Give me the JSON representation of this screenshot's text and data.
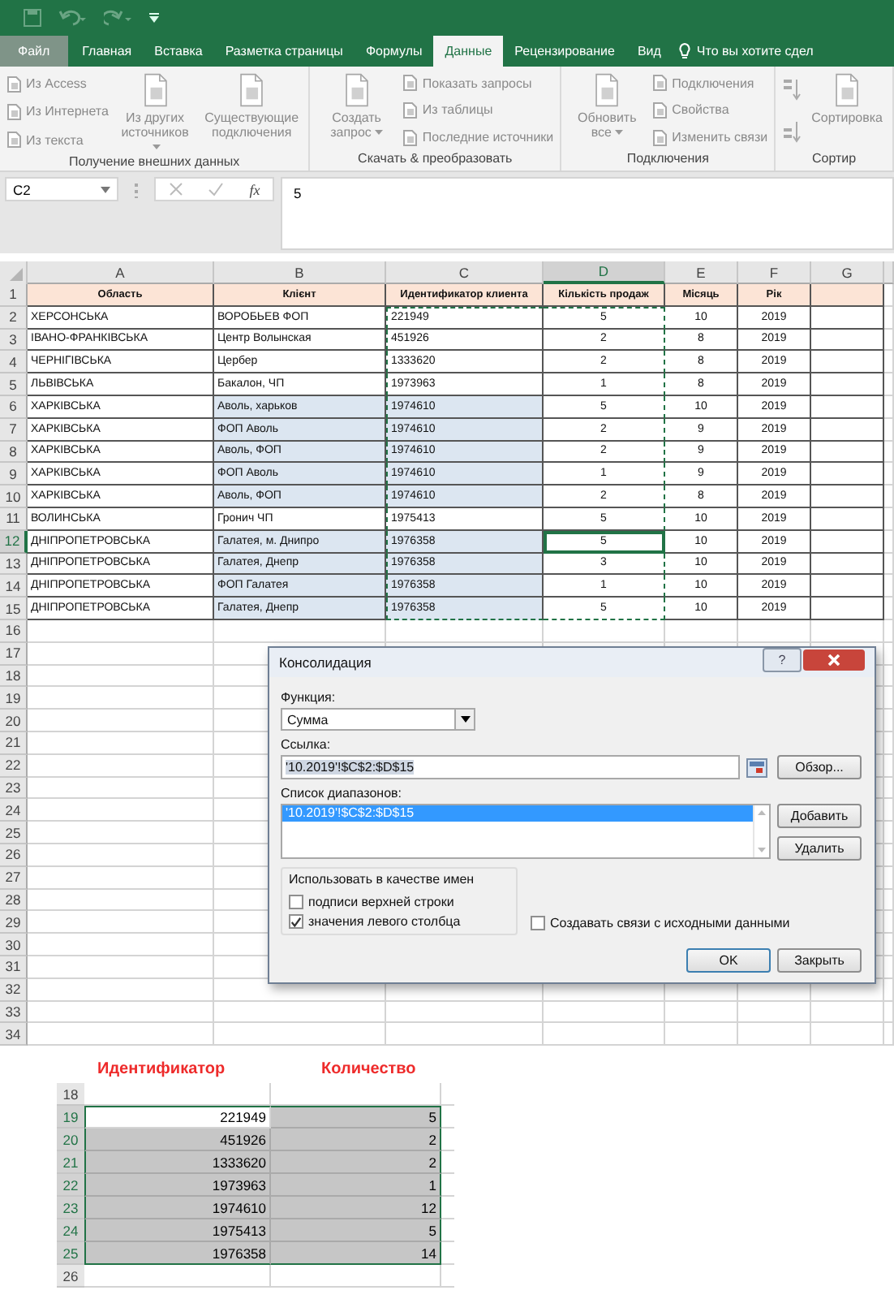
{
  "tabs": [
    {
      "label": "Файл",
      "kind": "file",
      "selected": false
    },
    {
      "label": "Главная",
      "kind": "tab",
      "selected": false
    },
    {
      "label": "Вставка",
      "kind": "tab",
      "selected": false
    },
    {
      "label": "Разметка страницы",
      "kind": "tab",
      "selected": false
    },
    {
      "label": "Формулы",
      "kind": "tab",
      "selected": false
    },
    {
      "label": "Данные",
      "kind": "tab",
      "selected": true
    },
    {
      "label": "Рецензирование",
      "kind": "tab",
      "selected": false
    },
    {
      "label": "Вид",
      "kind": "tab",
      "selected": false
    }
  ],
  "tell_me": "Что вы хотите сдел",
  "ribbon_groups": [
    {
      "label": "Получение внешних данных",
      "items": [
        {
          "kind": "stack",
          "items": [
            "Из Access",
            "Из Интернета",
            "Из текста"
          ]
        },
        {
          "kind": "large",
          "label": "Из других источников",
          "dropdown": true
        },
        {
          "kind": "large",
          "label": "Существующие подключения",
          "dropdown": false
        }
      ]
    },
    {
      "label": "Скачать & преобразовать",
      "items": [
        {
          "kind": "large",
          "label": "Создать запрос",
          "dropdown": true
        },
        {
          "kind": "stack",
          "items": [
            "Показать запросы",
            "Из таблицы",
            "Последние источники"
          ]
        }
      ]
    },
    {
      "label": "Подключения",
      "items": [
        {
          "kind": "large",
          "label": "Обновить все",
          "dropdown": true
        },
        {
          "kind": "stack",
          "items": [
            "Подключения",
            "Свойства",
            "Изменить связи"
          ]
        }
      ]
    },
    {
      "label": "Сортир",
      "items": [
        {
          "kind": "sort-icons"
        },
        {
          "kind": "large",
          "label": "Сортировка",
          "dropdown": false
        }
      ]
    }
  ],
  "formula_bar": {
    "name_box": "C2",
    "function_button": "fx",
    "value": "5"
  },
  "sheet": {
    "columns": [
      {
        "label": "A",
        "selected": false,
        "copied": false
      },
      {
        "label": "B",
        "selected": false,
        "copied": false
      },
      {
        "label": "C",
        "selected": false,
        "copied": true
      },
      {
        "label": "D",
        "selected": true,
        "copied": true
      },
      {
        "label": "E",
        "selected": false,
        "copied": false
      },
      {
        "label": "F",
        "selected": false,
        "copied": false
      },
      {
        "label": "G",
        "selected": false,
        "copied": false
      }
    ],
    "rows": [
      {
        "number": "1",
        "kind": "header",
        "selected": false,
        "cells": [
          "Область",
          "Клієнт",
          "Идентификатор клиента",
          "Кількість продаж",
          "Місяць",
          "Рік"
        ]
      },
      {
        "number": "2",
        "kind": "data",
        "selected": false,
        "shaded": false,
        "copied": true,
        "cells": [
          "ХЕРСОНСЬКА",
          "ВОРОБЬЕВ ФОП",
          "221949",
          "5",
          "10",
          "2019"
        ]
      },
      {
        "number": "3",
        "kind": "data",
        "selected": false,
        "shaded": false,
        "copied": true,
        "cells": [
          "ІВАНО-ФРАНКІВСЬКА",
          "Центр Волынская",
          "451926",
          "2",
          "8",
          "2019"
        ]
      },
      {
        "number": "4",
        "kind": "data",
        "selected": false,
        "shaded": false,
        "copied": true,
        "cells": [
          "ЧЕРНІГІВСЬКА",
          "Цербер",
          "1333620",
          "2",
          "8",
          "2019"
        ]
      },
      {
        "number": "5",
        "kind": "data",
        "selected": false,
        "shaded": false,
        "copied": true,
        "cells": [
          "ЛЬВІВСЬКА",
          "Бакалон, ЧП",
          "1973963",
          "1",
          "8",
          "2019"
        ]
      },
      {
        "number": "6",
        "kind": "data",
        "selected": false,
        "shaded": true,
        "copied": true,
        "cells": [
          "ХАРКІВСЬКА",
          "Аволь, харьков",
          "1974610",
          "5",
          "10",
          "2019"
        ]
      },
      {
        "number": "7",
        "kind": "data",
        "selected": false,
        "shaded": true,
        "copied": true,
        "cells": [
          "ХАРКІВСЬКА",
          "ФОП Аволь",
          "1974610",
          "2",
          "9",
          "2019"
        ]
      },
      {
        "number": "8",
        "kind": "data",
        "selected": false,
        "shaded": true,
        "copied": true,
        "cells": [
          "ХАРКІВСЬКА",
          "Аволь, ФОП",
          "1974610",
          "2",
          "9",
          "2019"
        ]
      },
      {
        "number": "9",
        "kind": "data",
        "selected": false,
        "shaded": true,
        "copied": true,
        "cells": [
          "ХАРКІВСЬКА",
          "ФОП Аволь",
          "1974610",
          "1",
          "9",
          "2019"
        ]
      },
      {
        "number": "10",
        "kind": "data",
        "selected": false,
        "shaded": true,
        "copied": true,
        "cells": [
          "ХАРКІВСЬКА",
          "Аволь, ФОП",
          "1974610",
          "2",
          "8",
          "2019"
        ]
      },
      {
        "number": "11",
        "kind": "data",
        "selected": false,
        "shaded": false,
        "copied": true,
        "cells": [
          "ВОЛИНСЬКА",
          "Гронич ЧП",
          "1975413",
          "5",
          "10",
          "2019"
        ]
      },
      {
        "number": "12",
        "kind": "data",
        "selected": true,
        "shaded": true,
        "copied": true,
        "cells": [
          "ДНІПРОПЕТРОВСЬКА",
          "Галатея, м. Днипро",
          "1976358",
          "5",
          "10",
          "2019"
        ]
      },
      {
        "number": "13",
        "kind": "data",
        "selected": false,
        "shaded": true,
        "copied": true,
        "cells": [
          "ДНІПРОПЕТРОВСЬКА",
          "Галатея, Днепр",
          "1976358",
          "3",
          "10",
          "2019"
        ]
      },
      {
        "number": "14",
        "kind": "data",
        "selected": false,
        "shaded": true,
        "copied": true,
        "cells": [
          "ДНІПРОПЕТРОВСЬКА",
          "ФОП Галатея",
          "1976358",
          "1",
          "10",
          "2019"
        ]
      },
      {
        "number": "15",
        "kind": "data",
        "selected": false,
        "shaded": true,
        "copied": true,
        "cells": [
          "ДНІПРОПЕТРОВСЬКА",
          "Галатея, Днепр",
          "1976358",
          "5",
          "10",
          "2019"
        ]
      },
      {
        "number": "16",
        "kind": "empty",
        "selected": false
      },
      {
        "number": "17",
        "kind": "empty",
        "selected": false
      },
      {
        "number": "18",
        "kind": "empty",
        "selected": false
      },
      {
        "number": "19",
        "kind": "empty",
        "selected": false
      },
      {
        "number": "20",
        "kind": "empty",
        "selected": false
      },
      {
        "number": "21",
        "kind": "empty",
        "selected": false
      },
      {
        "number": "22",
        "kind": "empty",
        "selected": false
      },
      {
        "number": "23",
        "kind": "empty",
        "selected": false
      },
      {
        "number": "24",
        "kind": "empty",
        "selected": false
      },
      {
        "number": "25",
        "kind": "empty",
        "selected": false
      },
      {
        "number": "26",
        "kind": "empty",
        "selected": false
      },
      {
        "number": "27",
        "kind": "empty",
        "selected": false
      },
      {
        "number": "28",
        "kind": "empty",
        "selected": false
      },
      {
        "number": "29",
        "kind": "empty",
        "selected": false
      },
      {
        "number": "30",
        "kind": "empty",
        "selected": false
      },
      {
        "number": "31",
        "kind": "empty",
        "selected": false
      },
      {
        "number": "32",
        "kind": "empty",
        "selected": false
      },
      {
        "number": "33",
        "kind": "empty",
        "selected": false
      },
      {
        "number": "34",
        "kind": "empty",
        "selected": false
      }
    ]
  },
  "dialog": {
    "title": "Консолидация",
    "help": "?",
    "function_label": "Функция:",
    "function_value": "Сумма",
    "reference_label": "Ссылка:",
    "reference_value": "'10.2019'!$C$2:$D$15",
    "browse_button": "Обзор...",
    "ranges_label": "Список диапазонов:",
    "ranges": [
      {
        "text": "'10.2019'!$C$2:$D$15",
        "selected": true
      }
    ],
    "add_button": "Добавить",
    "delete_button": "Удалить",
    "use_labels_title": "Использовать в качестве имен",
    "checkboxes": [
      {
        "label": "подписи верхней строки",
        "checked": false
      },
      {
        "label": "значения левого столбца",
        "checked": true
      }
    ],
    "links_checkbox": {
      "label": "Создавать связи с исходными данными",
      "checked": false
    },
    "ok_button": "OK",
    "close_button": "Закрыть"
  },
  "result": {
    "headers": [
      "Идентификатор",
      "Количество"
    ],
    "rows": [
      {
        "number": "18",
        "selected": false
      },
      {
        "number": "19",
        "selected": true,
        "active": true,
        "cells": [
          "221949",
          "5"
        ]
      },
      {
        "number": "20",
        "selected": true,
        "cells": [
          "451926",
          "2"
        ]
      },
      {
        "number": "21",
        "selected": true,
        "cells": [
          "1333620",
          "2"
        ]
      },
      {
        "number": "22",
        "selected": true,
        "cells": [
          "1973963",
          "1"
        ]
      },
      {
        "number": "23",
        "selected": true,
        "cells": [
          "1974610",
          "12"
        ]
      },
      {
        "number": "24",
        "selected": true,
        "cells": [
          "1975413",
          "5"
        ]
      },
      {
        "number": "25",
        "selected": true,
        "cells": [
          "1976358",
          "14"
        ]
      },
      {
        "number": "26",
        "selected": false
      }
    ]
  }
}
